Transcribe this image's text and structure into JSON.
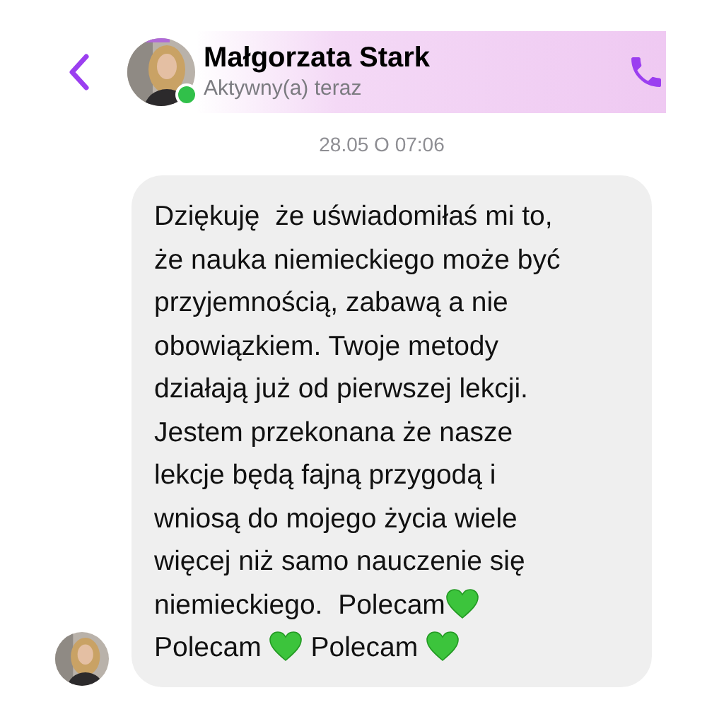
{
  "header": {
    "name": "Małgorzata Stark",
    "status": "Aktywny(a) teraz",
    "online": true
  },
  "timestamp": "28.05 O 07:06",
  "message": {
    "lines": [
      [
        {
          "kind": "text",
          "text": "Dziękuję  że uświadomiłaś mi to,"
        }
      ],
      [
        {
          "kind": "text",
          "text": "że nauka niemieckiego może być"
        }
      ],
      [
        {
          "kind": "text",
          "text": "przyjemnością, zabawą a nie"
        }
      ],
      [
        {
          "kind": "text",
          "text": "obowiązkiem. Twoje metody"
        }
      ],
      [
        {
          "kind": "text",
          "text": "działają już od pierwszej lekcji."
        }
      ],
      [
        {
          "kind": "text",
          "text": "Jestem przekonana że nasze"
        }
      ],
      [
        {
          "kind": "text",
          "text": "lekcje będą fajną przygodą i"
        }
      ],
      [
        {
          "kind": "text",
          "text": "wniosą do mojego życia wiele"
        }
      ],
      [
        {
          "kind": "text",
          "text": "więcej niż samo nauczenie się"
        }
      ],
      [
        {
          "kind": "text",
          "text": "niemieckiego.  Polecam"
        },
        {
          "kind": "heart"
        }
      ],
      [
        {
          "kind": "text",
          "text": "Polecam "
        },
        {
          "kind": "heart"
        },
        {
          "kind": "text",
          "text": " Polecam "
        },
        {
          "kind": "heart"
        }
      ]
    ]
  }
}
